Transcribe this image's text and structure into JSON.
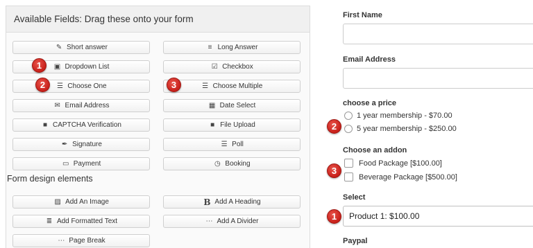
{
  "palette": {
    "badge": "#d62b24",
    "panel_header_bg": "#f0f0f0",
    "button_border": "#cfcfcf"
  },
  "left_panel": {
    "title": "Available Fields: Drag these onto your form",
    "fields": [
      {
        "label": "Short answer",
        "icon": "edit-icon",
        "glyph": "✎"
      },
      {
        "label": "Long Answer",
        "icon": "paragraph-icon",
        "glyph": "≡"
      },
      {
        "label": "Dropdown List",
        "icon": "dropdown-icon",
        "glyph": "▣"
      },
      {
        "label": "Checkbox",
        "icon": "checkbox-icon",
        "glyph": "☑"
      },
      {
        "label": "Choose One",
        "icon": "list-icon",
        "glyph": "☰"
      },
      {
        "label": "Choose Multiple",
        "icon": "list-icon",
        "glyph": "☰"
      },
      {
        "label": "Email Address",
        "icon": "envelope-icon",
        "glyph": "✉"
      },
      {
        "label": "Date Select",
        "icon": "calendar-icon",
        "glyph": "▦"
      },
      {
        "label": "CAPTCHA Verification",
        "icon": "lock-icon",
        "glyph": "■"
      },
      {
        "label": "File Upload",
        "icon": "lock-icon",
        "glyph": "■"
      },
      {
        "label": "Signature",
        "icon": "pen-icon",
        "glyph": "✒"
      },
      {
        "label": "Poll",
        "icon": "list-icon",
        "glyph": "☰"
      },
      {
        "label": "Payment",
        "icon": "credit-card-icon",
        "glyph": "▭"
      },
      {
        "label": "Booking",
        "icon": "clock-icon",
        "glyph": "◷"
      }
    ],
    "design_section_label": "Form design elements",
    "design_elements": [
      {
        "label": "Add An Image",
        "icon": "image-icon",
        "glyph": "▨"
      },
      {
        "label": "Add A Heading",
        "icon": "bold-icon",
        "glyph": "B"
      },
      {
        "label": "Add Formatted Text",
        "icon": "align-icon",
        "glyph": "≣"
      },
      {
        "label": "Add A Divider",
        "icon": "ellipsis-icon",
        "glyph": "⋯"
      },
      {
        "label": "Page Break",
        "icon": "ellipsis-icon",
        "glyph": "⋯"
      }
    ],
    "badges": [
      "1",
      "2",
      "3"
    ]
  },
  "form": {
    "first_name_label": "First Name",
    "email_label": "Email Address",
    "price_label": "choose a price",
    "price_options": [
      "1 year membership - $70.00",
      "5 year membership - $250.00"
    ],
    "addon_label": "Choose an addon",
    "addon_options": [
      "Food Package [$100.00]",
      "Beverage Package [$500.00]"
    ],
    "select_label": "Select",
    "select_value": "Product 1: $100.00",
    "paypal_label": "Paypal",
    "badges": [
      "2",
      "3",
      "1"
    ]
  }
}
